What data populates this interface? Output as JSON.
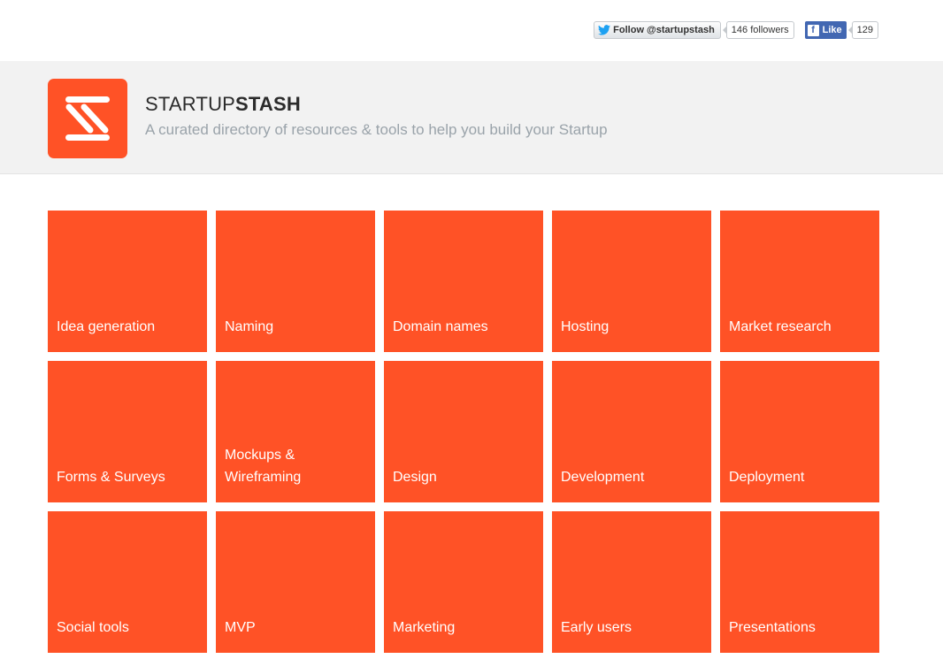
{
  "social": {
    "twitter_follow_label": "Follow @startupstash",
    "twitter_followers": "146 followers",
    "facebook_like_label": "Like",
    "facebook_count": "129",
    "facebook_icon_letter": "f"
  },
  "header": {
    "brand_regular": "STARTUP",
    "brand_bold": "STASH",
    "tagline": "A curated directory of resources & tools to help you build your Startup",
    "logo_icon": "stash-logo-icon"
  },
  "colors": {
    "accent": "#ff5226",
    "header_bg": "#f2f2f2",
    "tagline": "#9aa3aa",
    "facebook": "#4267b2",
    "twitter": "#1da1f2"
  },
  "categories": [
    "Idea generation",
    "Naming",
    "Domain names",
    "Hosting",
    "Market research",
    "Forms & Surveys",
    "Mockups & Wireframing",
    "Design",
    "Development",
    "Deployment",
    "Social tools",
    "MVP",
    "Marketing",
    "Early users",
    "Presentations"
  ]
}
